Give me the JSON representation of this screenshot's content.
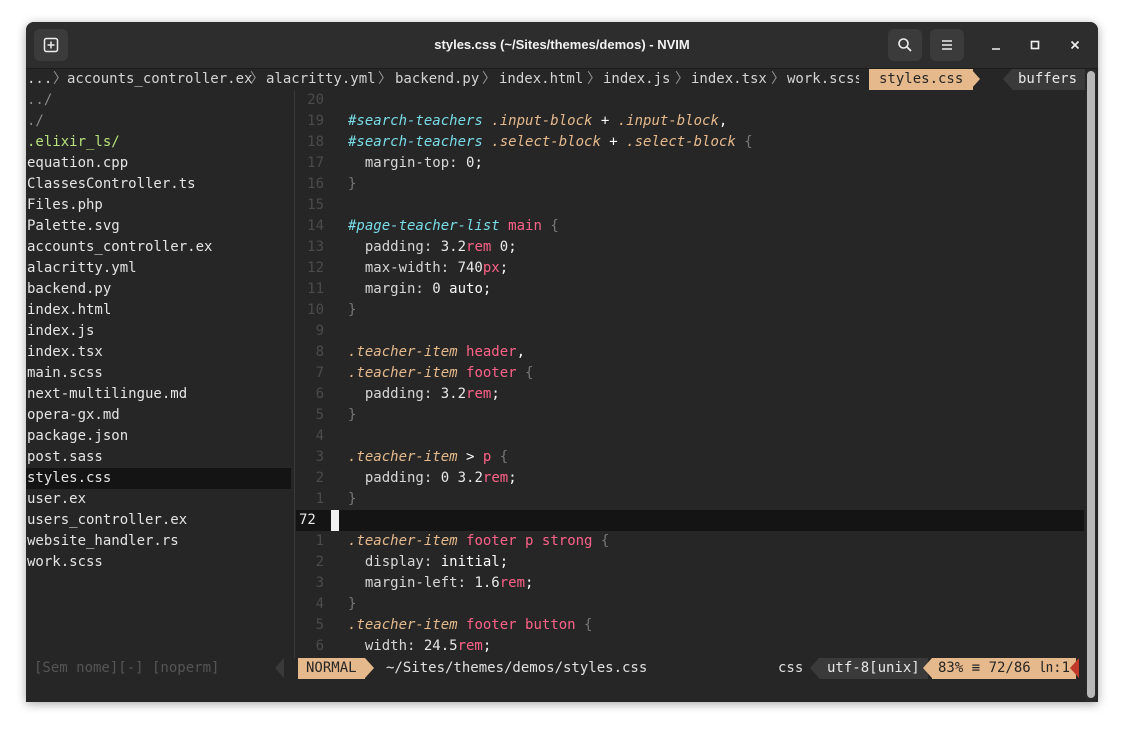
{
  "window": {
    "title": "styles.css (~/Sites/themes/demos) - NVIM",
    "new_tab_icon": "new-tab-icon",
    "search_icon": "search-icon",
    "menu_icon": "hamburger-menu-icon",
    "minimize_glyph": "–",
    "maximize_glyph": "□",
    "close_glyph": "×"
  },
  "tabline": {
    "ellipsis": "...",
    "tabs": [
      "accounts_controller.ex",
      "alacritty.yml",
      "backend.py",
      "index.html",
      "index.js",
      "index.tsx",
      "work.scss"
    ],
    "active_tab": "styles.css",
    "buffers_label": "buffers"
  },
  "tree": {
    "items": [
      {
        "label": "../",
        "style": "dim"
      },
      {
        "label": "./",
        "style": "dim"
      },
      {
        "label": ".elixir_ls/",
        "style": "green"
      },
      {
        "label": "equation.cpp",
        "style": ""
      },
      {
        "label": "ClassesController.ts",
        "style": ""
      },
      {
        "label": "Files.php",
        "style": ""
      },
      {
        "label": "Palette.svg",
        "style": ""
      },
      {
        "label": "accounts_controller.ex",
        "style": ""
      },
      {
        "label": "alacritty.yml",
        "style": ""
      },
      {
        "label": "backend.py",
        "style": ""
      },
      {
        "label": "index.html",
        "style": ""
      },
      {
        "label": "index.js",
        "style": ""
      },
      {
        "label": "index.tsx",
        "style": ""
      },
      {
        "label": "main.scss",
        "style": ""
      },
      {
        "label": "next-multilingue.md",
        "style": ""
      },
      {
        "label": "opera-gx.md",
        "style": ""
      },
      {
        "label": "package.json",
        "style": ""
      },
      {
        "label": "post.sass",
        "style": ""
      },
      {
        "label": "styles.css",
        "style": "sel"
      },
      {
        "label": "user.ex",
        "style": ""
      },
      {
        "label": "users_controller.ex",
        "style": ""
      },
      {
        "label": "website_handler.rs",
        "style": ""
      },
      {
        "label": "work.scss",
        "style": ""
      }
    ]
  },
  "code": {
    "current_line_number": "72",
    "lines": [
      {
        "n": "20",
        "tokens": []
      },
      {
        "n": "19",
        "tokens": [
          [
            "sel-id",
            "#search-teachers"
          ],
          [
            "kw",
            " "
          ],
          [
            "sel-cls",
            ".input-block"
          ],
          [
            "kw",
            " + "
          ],
          [
            "sel-cls",
            ".input-block"
          ],
          [
            "kw",
            ","
          ]
        ]
      },
      {
        "n": "18",
        "tokens": [
          [
            "sel-id",
            "#search-teachers"
          ],
          [
            "kw",
            " "
          ],
          [
            "sel-cls",
            ".select-block"
          ],
          [
            "kw",
            " + "
          ],
          [
            "sel-cls",
            ".select-block"
          ],
          [
            "kw",
            " "
          ],
          [
            "brace",
            "{"
          ]
        ]
      },
      {
        "n": "17",
        "tokens": [
          [
            "prop",
            "  margin-top: "
          ],
          [
            "num",
            "0"
          ],
          [
            "kw",
            ";"
          ]
        ]
      },
      {
        "n": "16",
        "tokens": [
          [
            "brace",
            "}"
          ]
        ]
      },
      {
        "n": "15",
        "tokens": []
      },
      {
        "n": "14",
        "tokens": [
          [
            "sel-id",
            "#page-teacher-list"
          ],
          [
            "kw",
            " "
          ],
          [
            "sel-tag",
            "main"
          ],
          [
            "kw",
            " "
          ],
          [
            "brace",
            "{"
          ]
        ]
      },
      {
        "n": "13",
        "tokens": [
          [
            "prop",
            "  padding: "
          ],
          [
            "num",
            "3.2"
          ],
          [
            "unit",
            "rem"
          ],
          [
            "kw",
            " "
          ],
          [
            "num",
            "0"
          ],
          [
            "kw",
            ";"
          ]
        ]
      },
      {
        "n": "12",
        "tokens": [
          [
            "prop",
            "  max-width: "
          ],
          [
            "num",
            "740"
          ],
          [
            "unit",
            "px"
          ],
          [
            "kw",
            ";"
          ]
        ]
      },
      {
        "n": "11",
        "tokens": [
          [
            "prop",
            "  margin: "
          ],
          [
            "num",
            "0"
          ],
          [
            "kw",
            " auto;"
          ]
        ]
      },
      {
        "n": "10",
        "tokens": [
          [
            "brace",
            "}"
          ]
        ]
      },
      {
        "n": "9",
        "tokens": []
      },
      {
        "n": "8",
        "tokens": [
          [
            "sel-cls",
            ".teacher-item"
          ],
          [
            "kw",
            " "
          ],
          [
            "sel-tag",
            "header"
          ],
          [
            "kw",
            ","
          ]
        ]
      },
      {
        "n": "7",
        "tokens": [
          [
            "sel-cls",
            ".teacher-item"
          ],
          [
            "kw",
            " "
          ],
          [
            "sel-tag",
            "footer"
          ],
          [
            "kw",
            " "
          ],
          [
            "brace",
            "{"
          ]
        ]
      },
      {
        "n": "6",
        "tokens": [
          [
            "prop",
            "  padding: "
          ],
          [
            "num",
            "3.2"
          ],
          [
            "unit",
            "rem"
          ],
          [
            "kw",
            ";"
          ]
        ]
      },
      {
        "n": "5",
        "tokens": [
          [
            "brace",
            "}"
          ]
        ]
      },
      {
        "n": "4",
        "tokens": []
      },
      {
        "n": "3",
        "tokens": [
          [
            "sel-cls",
            ".teacher-item"
          ],
          [
            "kw",
            " > "
          ],
          [
            "sel-tag",
            "p"
          ],
          [
            "kw",
            " "
          ],
          [
            "brace",
            "{"
          ]
        ]
      },
      {
        "n": "2",
        "tokens": [
          [
            "prop",
            "  padding: "
          ],
          [
            "num",
            "0"
          ],
          [
            "kw",
            " "
          ],
          [
            "num",
            "3.2"
          ],
          [
            "unit",
            "rem"
          ],
          [
            "kw",
            ";"
          ]
        ]
      },
      {
        "n": "1",
        "tokens": [
          [
            "brace",
            "}"
          ]
        ]
      },
      {
        "n": "72",
        "tokens": [],
        "current": true
      },
      {
        "n": "1",
        "tokens": [
          [
            "sel-cls",
            ".teacher-item"
          ],
          [
            "kw",
            " "
          ],
          [
            "sel-tag",
            "footer"
          ],
          [
            "kw",
            " "
          ],
          [
            "sel-tag",
            "p"
          ],
          [
            "kw",
            " "
          ],
          [
            "sel-tag",
            "strong"
          ],
          [
            "kw",
            " "
          ],
          [
            "brace",
            "{"
          ]
        ]
      },
      {
        "n": "2",
        "tokens": [
          [
            "prop",
            "  display: "
          ],
          [
            "kw",
            "initial;"
          ]
        ]
      },
      {
        "n": "3",
        "tokens": [
          [
            "prop",
            "  margin-left: "
          ],
          [
            "num",
            "1.6"
          ],
          [
            "unit",
            "rem"
          ],
          [
            "kw",
            ";"
          ]
        ]
      },
      {
        "n": "4",
        "tokens": [
          [
            "brace",
            "}"
          ]
        ]
      },
      {
        "n": "5",
        "tokens": [
          [
            "sel-cls",
            ".teacher-item"
          ],
          [
            "kw",
            " "
          ],
          [
            "sel-tag",
            "footer"
          ],
          [
            "kw",
            " "
          ],
          [
            "sel-tag",
            "button"
          ],
          [
            "kw",
            " "
          ],
          [
            "brace",
            "{"
          ]
        ]
      },
      {
        "n": "6",
        "tokens": [
          [
            "prop",
            "  width: "
          ],
          [
            "num",
            "24.5"
          ],
          [
            "unit",
            "rem"
          ],
          [
            "kw",
            ";"
          ]
        ]
      }
    ]
  },
  "statusline": {
    "tree_status": "[Sem nome][-] [noperm]",
    "mode": "NORMAL",
    "path": "~/Sites/themes/demos/styles.css",
    "filetype": "css",
    "encoding": "utf-8[unix]",
    "position": "83% ≡ 72/86 ㏑:1"
  },
  "colors": {
    "accent": "#e6b98c",
    "selector_id": "#78dce8",
    "tag": "#ff6188",
    "background": "#262626"
  }
}
